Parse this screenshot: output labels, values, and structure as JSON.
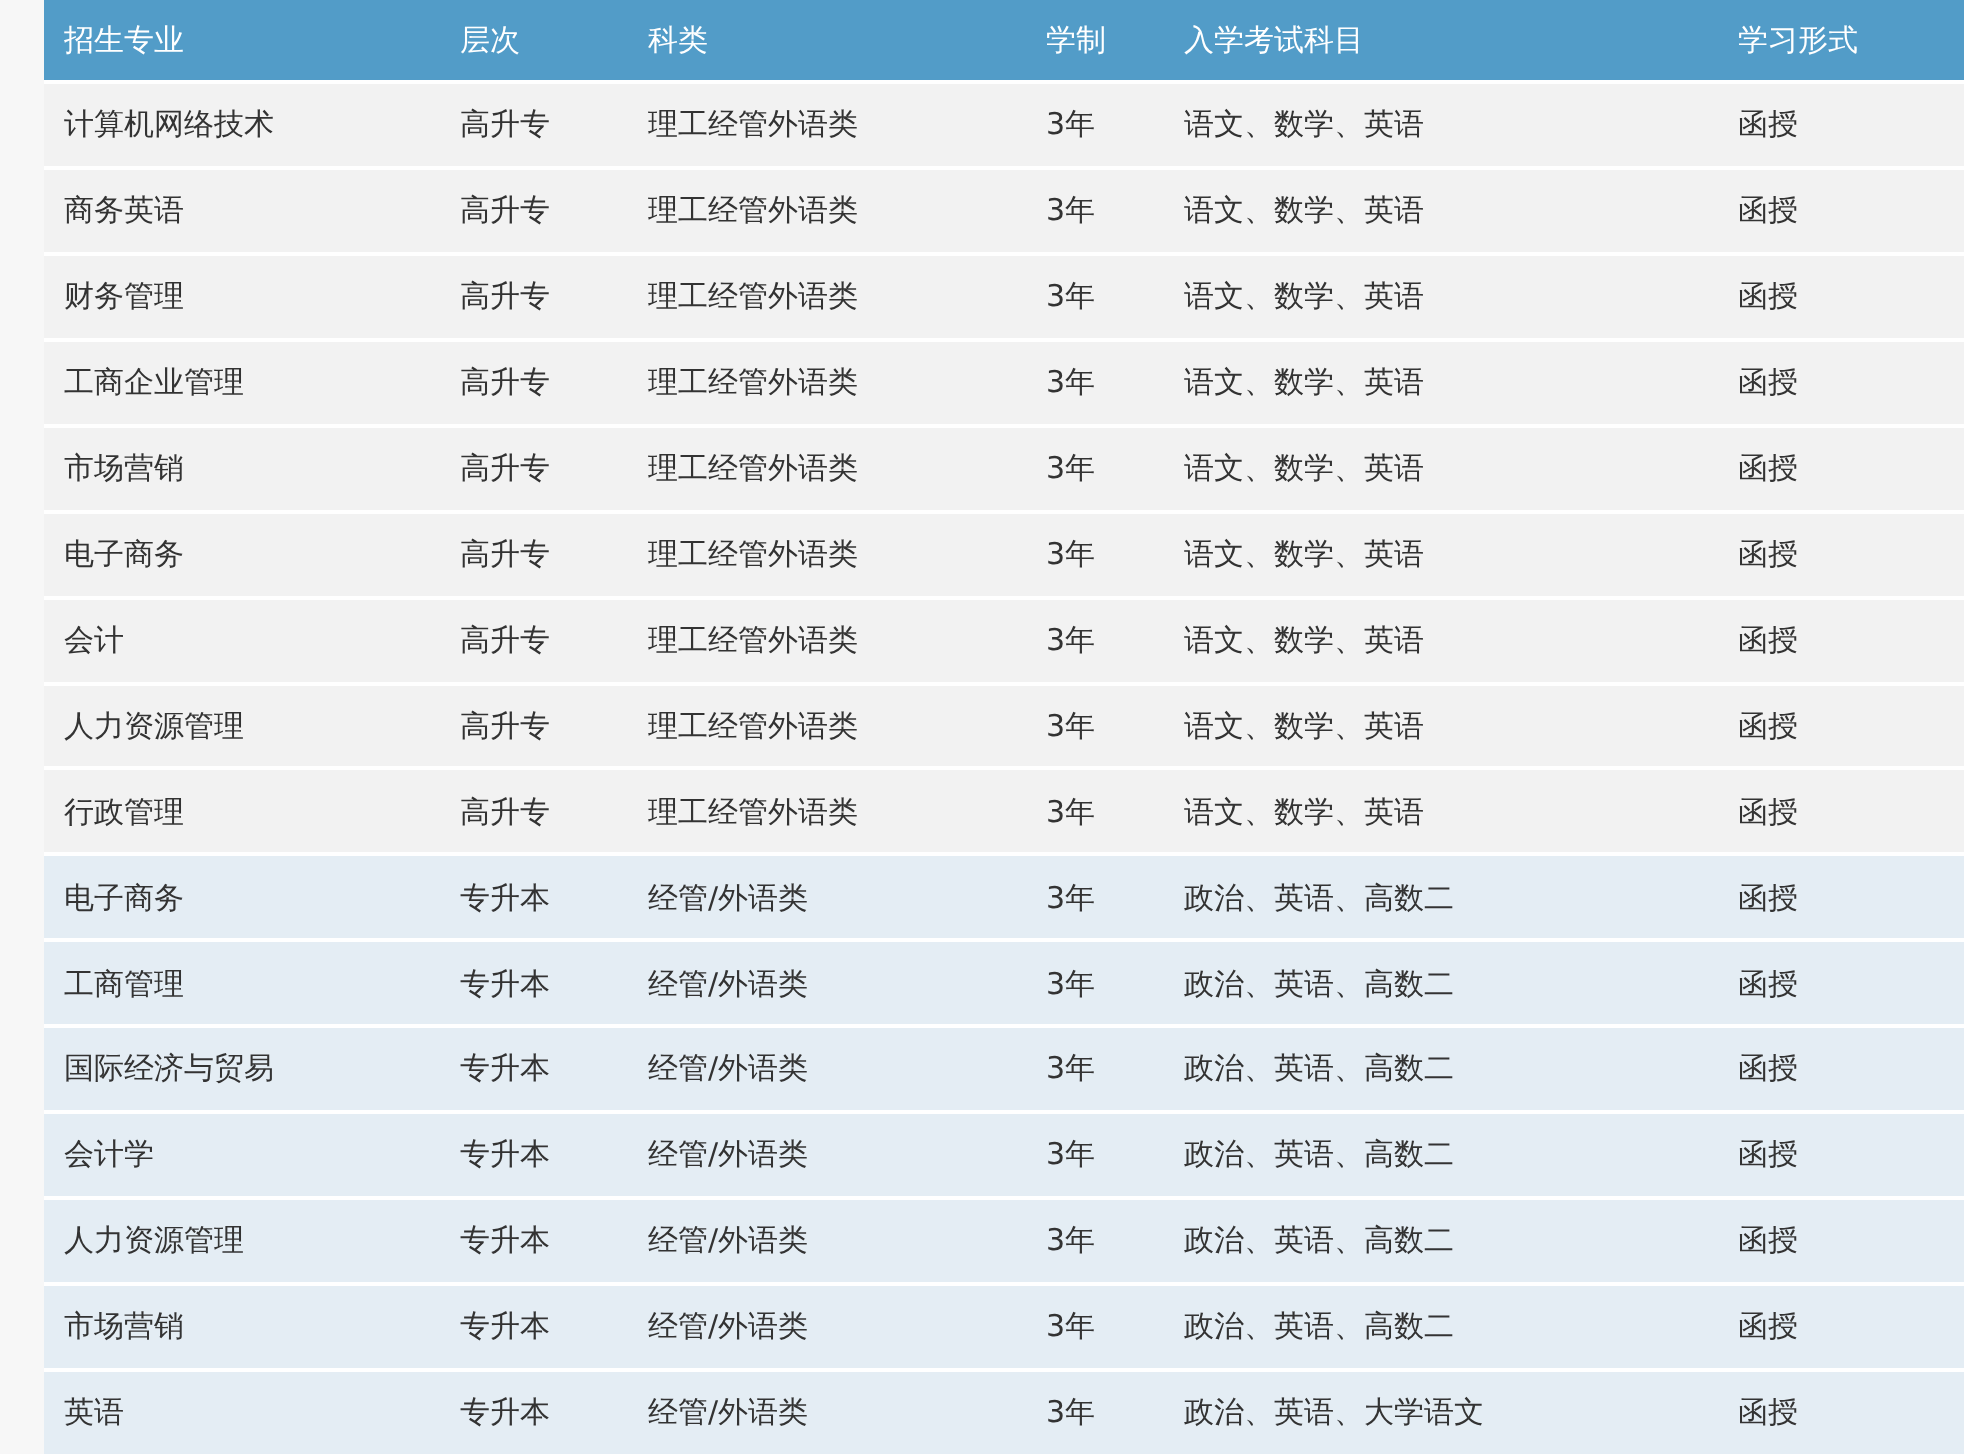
{
  "table": {
    "columns": [
      "招生专业",
      "层次",
      "科类",
      "学制",
      "入学考试科目",
      "学习形式"
    ],
    "rows": [
      {
        "kind": "junior",
        "cells": [
          "计算机网络技术",
          "高升专",
          "理工经管外语类",
          "3年",
          "语文、数学、英语",
          "函授"
        ]
      },
      {
        "kind": "junior",
        "cells": [
          "商务英语",
          "高升专",
          "理工经管外语类",
          "3年",
          "语文、数学、英语",
          "函授"
        ]
      },
      {
        "kind": "junior",
        "cells": [
          "财务管理",
          "高升专",
          "理工经管外语类",
          "3年",
          "语文、数学、英语",
          "函授"
        ]
      },
      {
        "kind": "junior",
        "cells": [
          "工商企业管理",
          "高升专",
          "理工经管外语类",
          "3年",
          "语文、数学、英语",
          "函授"
        ]
      },
      {
        "kind": "junior",
        "cells": [
          "市场营销",
          "高升专",
          "理工经管外语类",
          "3年",
          "语文、数学、英语",
          "函授"
        ]
      },
      {
        "kind": "junior",
        "cells": [
          "电子商务",
          "高升专",
          "理工经管外语类",
          "3年",
          "语文、数学、英语",
          "函授"
        ]
      },
      {
        "kind": "junior",
        "cells": [
          "会计",
          "高升专",
          "理工经管外语类",
          "3年",
          "语文、数学、英语",
          "函授"
        ]
      },
      {
        "kind": "junior",
        "cells": [
          "人力资源管理",
          "高升专",
          "理工经管外语类",
          "3年",
          "语文、数学、英语",
          "函授"
        ]
      },
      {
        "kind": "junior",
        "cells": [
          "行政管理",
          "高升专",
          "理工经管外语类",
          "3年",
          "语文、数学、英语",
          "函授"
        ]
      },
      {
        "kind": "upgrade",
        "cells": [
          "电子商务",
          "专升本",
          "经管/外语类",
          "3年",
          "政治、英语、高数二",
          "函授"
        ]
      },
      {
        "kind": "upgrade",
        "cells": [
          "工商管理",
          "专升本",
          "经管/外语类",
          "3年",
          "政治、英语、高数二",
          "函授"
        ]
      },
      {
        "kind": "upgrade",
        "cells": [
          "国际经济与贸易",
          "专升本",
          "经管/外语类",
          "3年",
          "政治、英语、高数二",
          "函授"
        ]
      },
      {
        "kind": "upgrade",
        "cells": [
          "会计学",
          "专升本",
          "经管/外语类",
          "3年",
          "政治、英语、高数二",
          "函授"
        ]
      },
      {
        "kind": "upgrade",
        "cells": [
          "人力资源管理",
          "专升本",
          "经管/外语类",
          "3年",
          "政治、英语、高数二",
          "函授"
        ]
      },
      {
        "kind": "upgrade",
        "cells": [
          "市场营销",
          "专升本",
          "经管/外语类",
          "3年",
          "政治、英语、高数二",
          "函授"
        ]
      },
      {
        "kind": "upgrade",
        "cells": [
          "英语",
          "专升本",
          "经管/外语类",
          "3年",
          "政治、英语、大学语文",
          "函授"
        ]
      }
    ]
  }
}
